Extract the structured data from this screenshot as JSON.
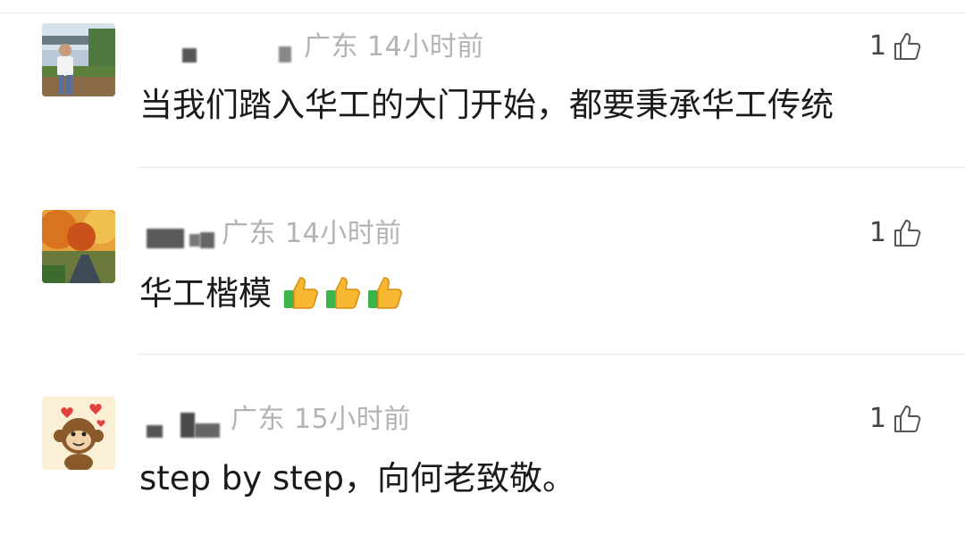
{
  "comments": [
    {
      "location": "广东",
      "time": "14小时前",
      "likes": "1",
      "text": "当我们踏入华工的大门开始，都要秉承华工传统",
      "avatar": "man-outdoor-photo-avatar"
    },
    {
      "location": "广东",
      "time": "14小时前",
      "likes": "1",
      "text": "华工楷模",
      "emoji": [
        "thumbs-up-emoji",
        "thumbs-up-emoji",
        "thumbs-up-emoji"
      ],
      "avatar": "autumn-road-photo-avatar"
    },
    {
      "location": "广东",
      "time": "15小时前",
      "likes": "1",
      "text": "step by step，向何老致敬。",
      "avatar": "cartoon-monkey-avatar"
    }
  ],
  "colors": {
    "meta": "#b3b3b3",
    "text": "#1b1b1b",
    "like": "#444444"
  }
}
